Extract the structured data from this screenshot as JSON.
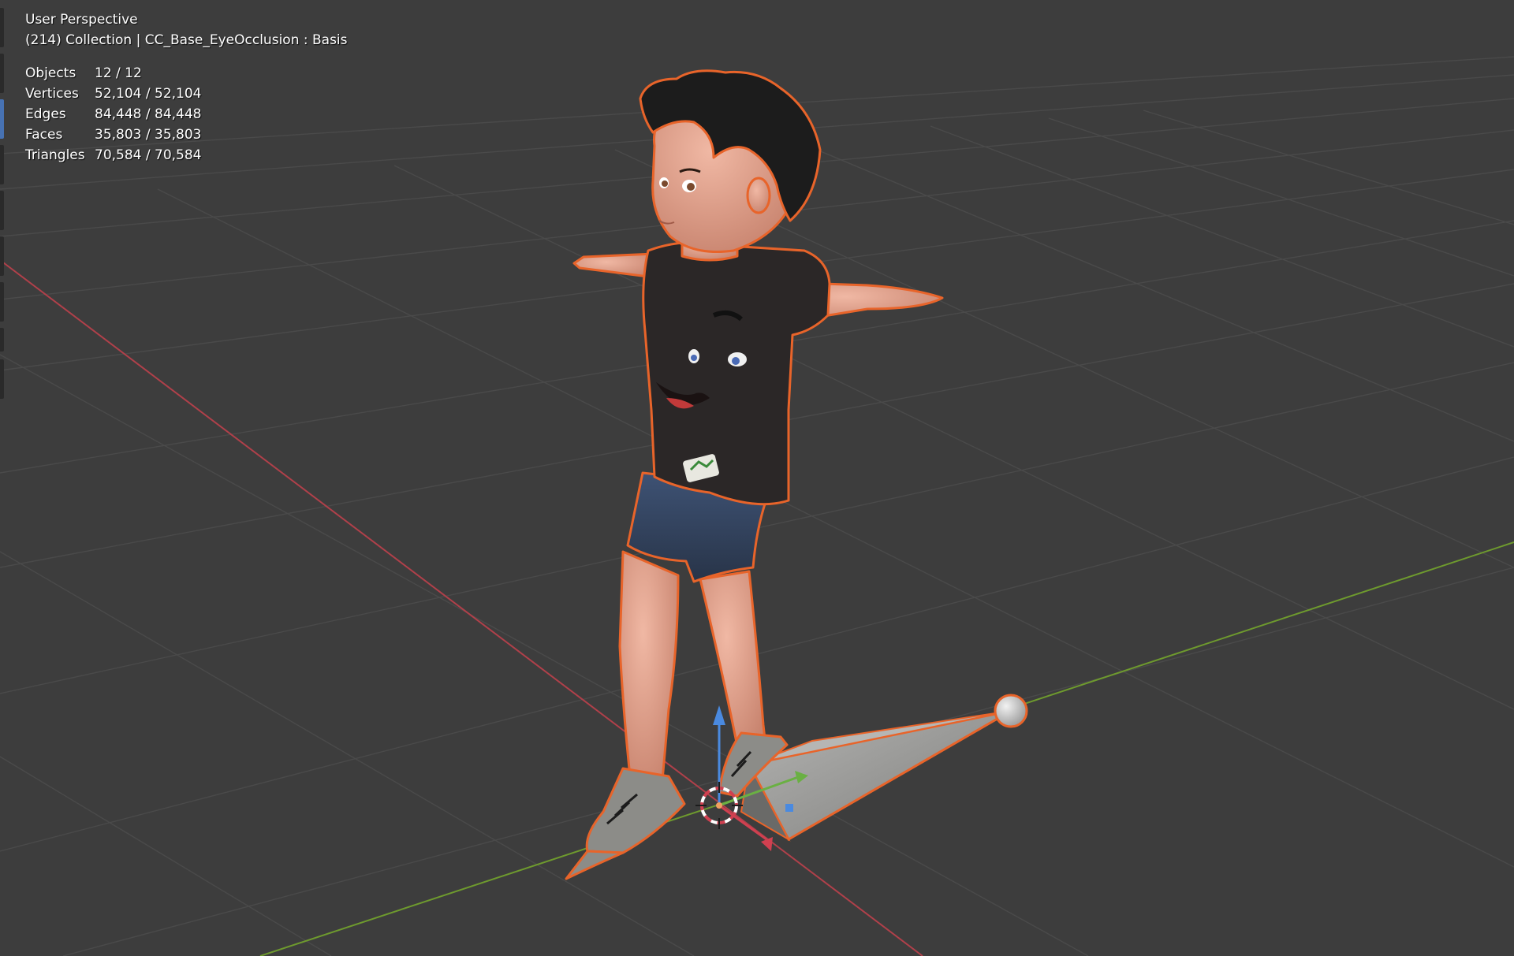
{
  "viewport": {
    "view_name": "User Perspective",
    "context": "(214) Collection | CC_Base_EyeOcclusion : Basis",
    "stats": [
      {
        "label": "Objects",
        "value": "12 / 12"
      },
      {
        "label": "Vertices",
        "value": "52,104 / 52,104"
      },
      {
        "label": "Edges",
        "value": "84,448 / 84,448"
      },
      {
        "label": "Faces",
        "value": "35,803 / 35,803"
      },
      {
        "label": "Triangles",
        "value": "70,584 / 70,584"
      }
    ]
  },
  "colors": {
    "background": "#3d3d3d",
    "grid_line": "#4a4a4a",
    "x_axis": "#b0404a",
    "y_axis": "#6e9a2e",
    "selection_outline": "#e8642a",
    "active_tool": "#4772b3",
    "shirt": "#2b2727",
    "shorts": "#33445e",
    "skin": "#e0a08e",
    "hair": "#1c1c1c",
    "shoe": "#8c8c88",
    "bone": "#9a9a98"
  },
  "icons": [
    "3d-cursor-icon",
    "gizmo-z-arrow-icon",
    "gizmo-y-arrow-icon",
    "gizmo-x-arrow-icon"
  ]
}
